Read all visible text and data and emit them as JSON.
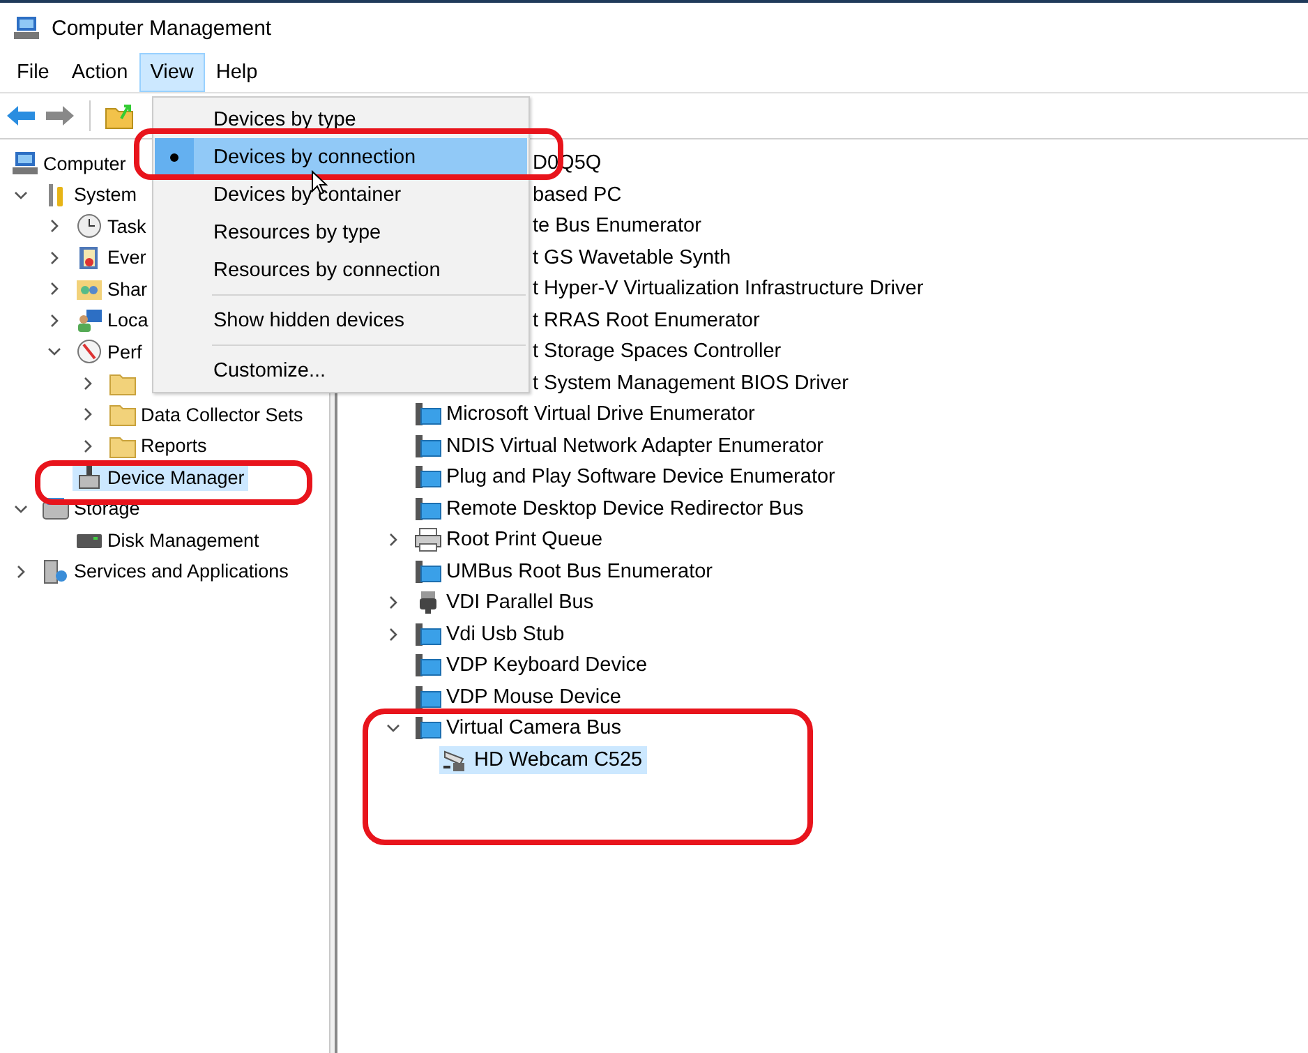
{
  "window": {
    "title": "Computer Management"
  },
  "menu_bar": [
    {
      "label": "File",
      "selected": false
    },
    {
      "label": "Action",
      "selected": false
    },
    {
      "label": "View",
      "selected": true
    },
    {
      "label": "Help",
      "selected": false
    }
  ],
  "view_menu": [
    [
      {
        "label": "Devices by type",
        "selected": false
      },
      {
        "label": "Devices by connection",
        "selected": true
      },
      {
        "label": "Devices by container",
        "selected": false
      },
      {
        "label": "Resources by type",
        "selected": false
      },
      {
        "label": "Resources by connection",
        "selected": false
      }
    ],
    [
      {
        "label": "Show hidden devices",
        "selected": false
      }
    ],
    [
      {
        "label": "Customize...",
        "selected": false
      }
    ]
  ],
  "console_tree": [
    {
      "label": "Computer",
      "kind": "computer",
      "selected": false,
      "children": [
        {
          "label": "System",
          "kind": "tools",
          "expanded": true,
          "selected": false,
          "children": [
            {
              "label": "Task",
              "kind": "clock",
              "expanded": false,
              "selected": false
            },
            {
              "label": "Ever",
              "kind": "log",
              "expanded": false,
              "selected": false
            },
            {
              "label": "Shar",
              "kind": "share",
              "expanded": false,
              "selected": false
            },
            {
              "label": "Loca",
              "kind": "users",
              "expanded": false,
              "selected": false
            },
            {
              "label": "Perf",
              "kind": "gauge",
              "expanded": true,
              "selected": false,
              "children": [
                {
                  "kind": "folder",
                  "expanded": false,
                  "selected": false
                },
                {
                  "label": "Data Collector Sets",
                  "kind": "folder",
                  "expanded": false,
                  "selected": false
                },
                {
                  "label": "Reports",
                  "kind": "folder",
                  "expanded": false,
                  "selected": false
                }
              ]
            },
            {
              "label": "Device Manager",
              "kind": "device",
              "selected": true
            }
          ]
        },
        {
          "label": "Storage",
          "kind": "storage",
          "expanded": true,
          "selected": false,
          "children": [
            {
              "label": "Disk Management",
              "kind": "disk",
              "selected": false
            }
          ]
        },
        {
          "label": "Services and Applications",
          "kind": "services",
          "expanded": false,
          "selected": false
        }
      ]
    }
  ],
  "device_tree": [
    {
      "label": "D0Q5Q",
      "kind": "partial"
    },
    {
      "label": "based PC",
      "kind": "partial"
    },
    {
      "label": "te Bus Enumerator",
      "kind": "partial"
    },
    {
      "label": "t GS Wavetable Synth",
      "kind": "partial"
    },
    {
      "label": "t Hyper-V Virtualization Infrastructure Driver",
      "kind": "partial"
    },
    {
      "label": "t RRAS Root Enumerator",
      "kind": "partial"
    },
    {
      "label": "t Storage Spaces Controller",
      "kind": "partial"
    },
    {
      "label": "t System Management BIOS Driver",
      "kind": "partial"
    },
    {
      "label": "Microsoft Virtual Drive Enumerator",
      "kind": "bus",
      "selected": false
    },
    {
      "label": "NDIS Virtual Network Adapter Enumerator",
      "kind": "bus",
      "selected": false
    },
    {
      "label": "Plug and Play Software Device Enumerator",
      "kind": "bus",
      "selected": false
    },
    {
      "label": "Remote Desktop Device Redirector Bus",
      "kind": "bus",
      "selected": false
    },
    {
      "label": "Root Print Queue",
      "kind": "printer",
      "expanded": false,
      "selected": false
    },
    {
      "label": "UMBus Root Bus Enumerator",
      "kind": "bus",
      "selected": false
    },
    {
      "label": "VDI Parallel Bus",
      "kind": "port",
      "expanded": false,
      "selected": false
    },
    {
      "label": "Vdi Usb Stub",
      "kind": "bus",
      "expanded": false,
      "selected": false
    },
    {
      "label": "VDP Keyboard Device",
      "kind": "bus",
      "selected": false
    },
    {
      "label": "VDP Mouse Device",
      "kind": "bus",
      "selected": false
    },
    {
      "label": "Virtual Camera Bus",
      "kind": "bus",
      "expanded": true,
      "selected": false,
      "children": [
        {
          "label": "HD Webcam C525",
          "kind": "webcam",
          "selected": true
        }
      ]
    }
  ]
}
